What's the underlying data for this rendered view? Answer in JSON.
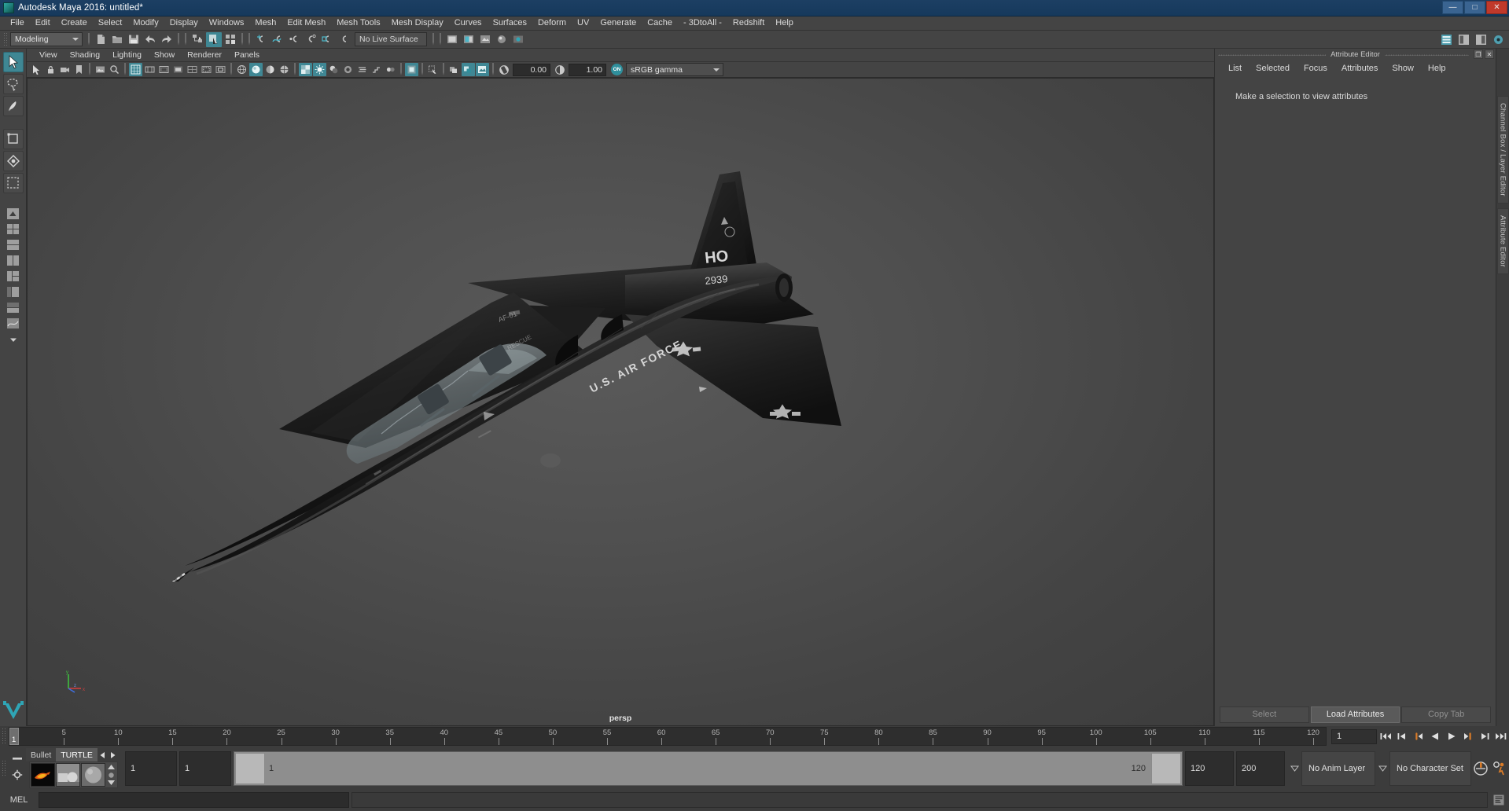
{
  "window": {
    "title": "Autodesk Maya 2016: untitled*",
    "icon": "maya-app-icon",
    "buttons": [
      {
        "name": "minimize",
        "glyph": "—"
      },
      {
        "name": "maximize",
        "glyph": "□"
      },
      {
        "name": "close",
        "glyph": "✕"
      }
    ]
  },
  "menubar": {
    "items": [
      "File",
      "Edit",
      "Create",
      "Select",
      "Modify",
      "Display",
      "Windows",
      "Mesh",
      "Edit Mesh",
      "Mesh Tools",
      "Mesh Display",
      "Curves",
      "Surfaces",
      "Deform",
      "UV",
      "Generate",
      "Cache",
      "- 3DtoAll -",
      "Redshift",
      "Help"
    ]
  },
  "statusline": {
    "mode": "Modeling",
    "live_surface": "No Live Surface",
    "icons": [
      "new-scene-icon",
      "open-scene-icon",
      "save-scene-icon",
      "undo-icon",
      "redo-icon",
      "select-hierarchy-icon",
      "select-object-icon",
      "select-component-icon",
      "snap-grid-icon",
      "snap-curve-icon",
      "snap-point-icon",
      "snap-projected-center-icon",
      "snap-view-plane-icon",
      "make-live-icon",
      "render-current-frame-icon",
      "ipr-render-icon",
      "render-settings-icon",
      "hypershade-icon",
      "render-view-icon"
    ],
    "right_icons": [
      "show-hide-channel-box-icon",
      "show-hide-layer-editor-icon",
      "show-hide-attribute-editor-icon",
      "show-hide-tool-settings-icon"
    ]
  },
  "toolbox": {
    "tools": [
      {
        "name": "select-tool",
        "selected": true
      },
      {
        "name": "lasso-select-tool",
        "selected": false
      },
      {
        "name": "paint-select-tool",
        "selected": false
      },
      {
        "name": "move-tool",
        "selected": false
      },
      {
        "name": "rotate-tool",
        "selected": false
      },
      {
        "name": "scale-tool",
        "selected": false
      },
      {
        "name": "last-tool-used",
        "selected": false
      }
    ],
    "layouts": [
      "single-perspective-layout",
      "four-view-layout",
      "two-pane-stacked-layout",
      "two-pane-side-layout",
      "three-pane-layout",
      "outliner-persp-layout",
      "hypergraph-persp-layout",
      "persp-graph-editor-layout",
      "more-layouts"
    ]
  },
  "viewport": {
    "panel_menu": [
      "View",
      "Shading",
      "Lighting",
      "Show",
      "Renderer",
      "Panels"
    ],
    "camera_label": "persp",
    "exposure": "0.00",
    "gamma": "1.00",
    "color_management": "sRGB gamma",
    "color_management_enabled": "ON",
    "axis_gizmo": {
      "x": "x",
      "y": "y",
      "z": "z"
    },
    "model": {
      "name": "Northrop T-38 Talon jet aircraft",
      "livery_markings": [
        "HO",
        "2939",
        "U.S. AIR FORCE"
      ]
    },
    "toolbar_icons": [
      "select-objects-icon",
      "lock-camera-icon",
      "camera-attributes-icon",
      "bookmark-icon",
      "image-plane-icon",
      "two-d-pan-zoom-icon",
      "grid-toggle-icon",
      "film-gate-icon",
      "resolution-gate-icon",
      "gate-mask-icon",
      "field-chart-icon",
      "safe-action-icon",
      "safe-title-icon",
      "wireframe-icon",
      "smooth-shade-all-icon",
      "smooth-shade-selected-icon",
      "wireframe-on-shaded-icon",
      "texture-icon",
      "use-all-lights-icon",
      "shadows-icon",
      "screen-space-ambient-occlusion-icon",
      "motion-blur-icon",
      "multisample-anti-aliasing-icon",
      "depth-of-field-icon",
      "isolate-select-icon",
      "xray-icon",
      "xray-joints-icon",
      "xray-active-components-icon",
      "exposure-icon",
      "gamma-icon"
    ]
  },
  "attribute_editor": {
    "title": "Attribute Editor",
    "menu": [
      "List",
      "Selected",
      "Focus",
      "Attributes",
      "Show",
      "Help"
    ],
    "empty_message": "Make a selection to view attributes",
    "footer_buttons": [
      {
        "label": "Select",
        "enabled": false
      },
      {
        "label": "Load Attributes",
        "enabled": true
      },
      {
        "label": "Copy Tab",
        "enabled": false
      }
    ],
    "window_buttons": [
      {
        "name": "undock",
        "glyph": "❐"
      },
      {
        "name": "close",
        "glyph": "✕"
      }
    ]
  },
  "right_tabs": [
    "Channel Box / Layer Editor",
    "Attribute Editor"
  ],
  "timeline": {
    "tick_labels": [
      5,
      10,
      15,
      20,
      25,
      30,
      35,
      40,
      45,
      50,
      55,
      60,
      65,
      70,
      75,
      80,
      85,
      90,
      95,
      100,
      105,
      110,
      115,
      120
    ],
    "range_start": 1,
    "range_end": 120,
    "current_frame": "1",
    "current_frame_field": "1",
    "playback_buttons": [
      "go-to-start-icon",
      "step-back-frame-icon",
      "step-back-key-icon",
      "play-backwards-icon",
      "play-forwards-icon",
      "step-forward-key-icon",
      "step-forward-frame-icon",
      "go-to-end-icon"
    ]
  },
  "range_slider": {
    "anim_start": "1",
    "anim_end": "1",
    "playback_start": "1",
    "playback_end": "120",
    "range_start_field": "120",
    "range_end_field": "200",
    "anim_layer": "No Anim Layer",
    "character_set": "No Character Set",
    "buttons": [
      "auto-key-icon",
      "animation-preferences-icon"
    ]
  },
  "shelf": {
    "tabs": [
      {
        "label": "Bullet",
        "selected": false
      },
      {
        "label": "TURTLE",
        "selected": true
      }
    ],
    "arrows": [
      "shelf-prev-icon",
      "shelf-next-icon"
    ],
    "icons": [
      "turtle-bake-icon",
      "turtle-render-icon",
      "turtle-material-icon"
    ],
    "side_buttons": [
      "shelf-menu-icon",
      "shelf-options-icon"
    ]
  },
  "command_line": {
    "label": "MEL",
    "input_value": "",
    "result_value": "",
    "script-editor-icon": "script-editor-icon"
  },
  "colors": {
    "accent": "#3f8794",
    "title_bar": "#1c3f63",
    "panel_bg": "#444444",
    "viewport_bg": "#4f4f4f",
    "field_bg": "#2c2c2c",
    "text": "#d2d2d2",
    "orange": "#d97b28"
  }
}
